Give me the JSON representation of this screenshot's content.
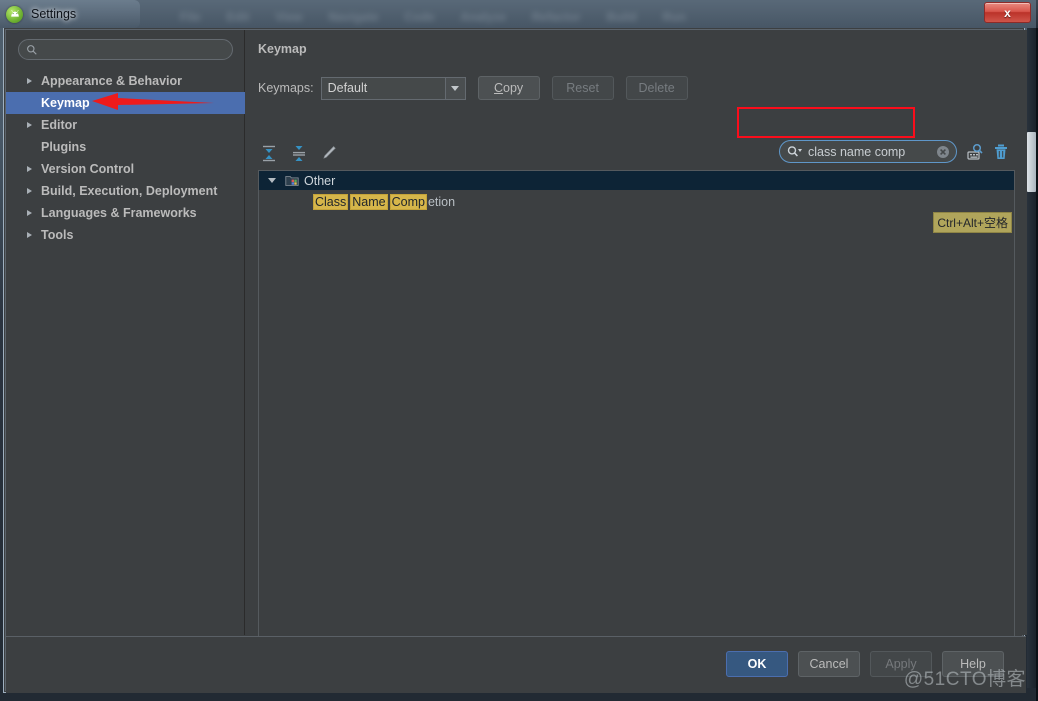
{
  "window": {
    "title": "Settings",
    "app_icon": "android-studio-icon",
    "close_label": "x"
  },
  "backdrop": {
    "blurred_menu_items": [
      "File",
      "Edit",
      "View",
      "Navigate",
      "Code",
      "Analyze",
      "Refactor",
      "Build",
      "Run"
    ]
  },
  "sidebar": {
    "search": {
      "value": "",
      "placeholder": ""
    },
    "items": [
      {
        "label": "Appearance & Behavior",
        "expandable": true,
        "selected": false
      },
      {
        "label": "Keymap",
        "expandable": false,
        "selected": true
      },
      {
        "label": "Editor",
        "expandable": true,
        "selected": false
      },
      {
        "label": "Plugins",
        "expandable": false,
        "selected": false
      },
      {
        "label": "Version Control",
        "expandable": true,
        "selected": false
      },
      {
        "label": "Build, Execution, Deployment",
        "expandable": true,
        "selected": false
      },
      {
        "label": "Languages & Frameworks",
        "expandable": true,
        "selected": false
      },
      {
        "label": "Tools",
        "expandable": true,
        "selected": false
      }
    ]
  },
  "content": {
    "pane_title": "Keymap",
    "keymaps_label": "Keymaps:",
    "keymap_selected": "Default",
    "keymap_options": [
      "Default"
    ],
    "buttons": {
      "copy": "Copy",
      "copy_mnemonic": "C",
      "copy_rest": "opy",
      "reset": "Reset",
      "delete": "Delete"
    },
    "toolbar_icons": [
      "expand-all-icon",
      "collapse-all-icon",
      "edit-shortcut-icon"
    ],
    "search": {
      "value": "class name comp",
      "placeholder": "",
      "icons": [
        "search-dropdown-icon",
        "clear-icon",
        "find-by-shortcut-icon",
        "reset-filter-icon"
      ]
    },
    "tree": {
      "group": {
        "label": "Other",
        "expanded": true,
        "icon": "folder-other-icon"
      },
      "rows": [
        {
          "segments": [
            {
              "text": "Class",
              "highlight": true
            },
            {
              "text": "Name",
              "highlight": true
            },
            {
              "text": "Comp",
              "highlight": true
            },
            {
              "text": "etion",
              "highlight": false
            }
          ],
          "shortcut": "Ctrl+Alt+空格"
        }
      ]
    }
  },
  "footer": {
    "ok": "OK",
    "cancel": "Cancel",
    "apply": "Apply",
    "help": "Help"
  },
  "annotations": {
    "arrow": "red-left-arrow",
    "highlight_box": "red-rectangle-around-search",
    "watermark": "@51CTO博客"
  },
  "colors": {
    "selection_blue": "#4b6eaf",
    "panel_bg": "#3c3f41",
    "tree_header_bg": "#0d2436",
    "highlight_yellow": "#d6b64a",
    "shortcut_badge": "#b0a55b",
    "annotation_red": "#fb0d1b",
    "primary_button": "#365880"
  }
}
